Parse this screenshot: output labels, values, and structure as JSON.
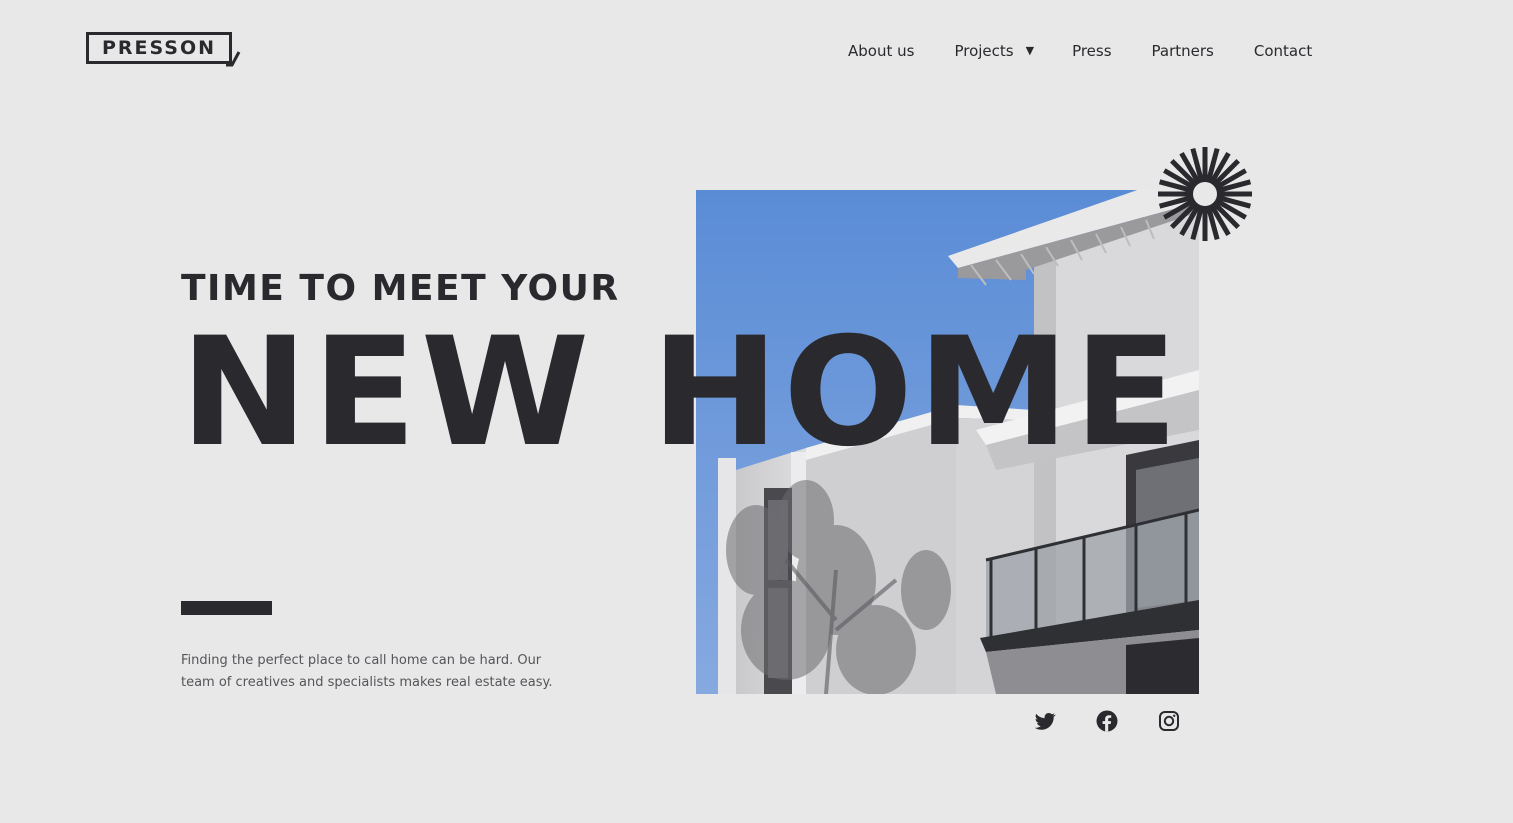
{
  "brand": {
    "name": "PRESSON"
  },
  "nav": {
    "items": [
      {
        "label": "About us"
      },
      {
        "label": "Projects",
        "has_dropdown": true,
        "dropdown_icon": "caret-down-icon"
      },
      {
        "label": "Press"
      },
      {
        "label": "Partners"
      },
      {
        "label": "Contact"
      }
    ]
  },
  "hero": {
    "kicker": "TIME TO MEET YOUR",
    "headline": "NEW HOME",
    "description": "Finding the perfect place to call home can be hard. Our team of creatives and specialists makes real estate easy.",
    "image_subject": "modern white apartment building with glass balcony against blue sky",
    "decoration_icon": "starburst-icon"
  },
  "social": {
    "links": [
      {
        "icon": "twitter-icon"
      },
      {
        "icon": "facebook-icon"
      },
      {
        "icon": "instagram-icon"
      }
    ]
  },
  "colors": {
    "background": "#e8e8e8",
    "ink": "#2a2a2e",
    "muted_text": "#55555a",
    "sky": "#5f8fd6"
  }
}
